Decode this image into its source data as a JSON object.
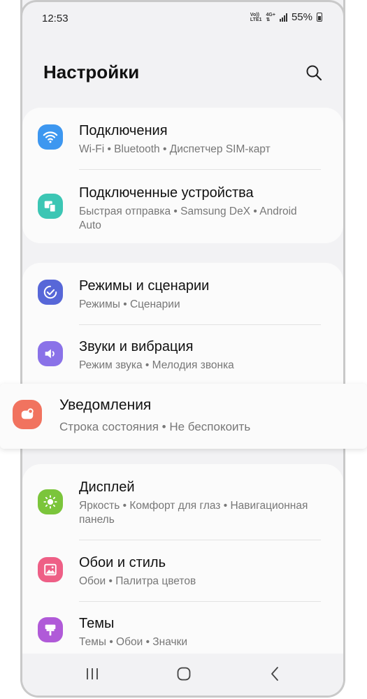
{
  "status": {
    "time": "12:53",
    "net_top": "Vo))",
    "net_bottom": "LTE1",
    "net_gen": "4G+",
    "battery": "55%"
  },
  "header": {
    "title": "Настройки"
  },
  "items": [
    {
      "title": "Подключения",
      "subtitle": "Wi-Fi  •  Bluetooth  •  Диспетчер SIM-карт",
      "icon": "wifi-icon",
      "color": "#3d97f0"
    },
    {
      "title": "Подключенные устройства",
      "subtitle": "Быстрая отправка  •  Samsung DeX  •  Android Auto",
      "icon": "devices-icon",
      "color": "#3cc6b4"
    },
    {
      "title": "Режимы и сценарии",
      "subtitle": "Режимы  •  Сценарии",
      "icon": "modes-icon",
      "color": "#5767d8"
    },
    {
      "title": "Звуки и вибрация",
      "subtitle": "Режим звука  •  Мелодия звонка",
      "icon": "sound-icon",
      "color": "#8a72e8"
    },
    {
      "title": "Уведомления",
      "subtitle": "Строка состояния  •  Не беспокоить",
      "icon": "notifications-icon",
      "color": "#f1735f"
    },
    {
      "title": "Дисплей",
      "subtitle": "Яркость  •  Комфорт для глаз  •  Навигационная панель",
      "icon": "brightness-icon",
      "color": "#7bc53b"
    },
    {
      "title": "Обои и стиль",
      "subtitle": "Обои  •  Палитра цветов",
      "icon": "wallpaper-icon",
      "color": "#ee5f86"
    },
    {
      "title": "Темы",
      "subtitle": "Темы  •  Обои  •  Значки",
      "icon": "themes-icon",
      "color": "#b05ad8"
    }
  ]
}
